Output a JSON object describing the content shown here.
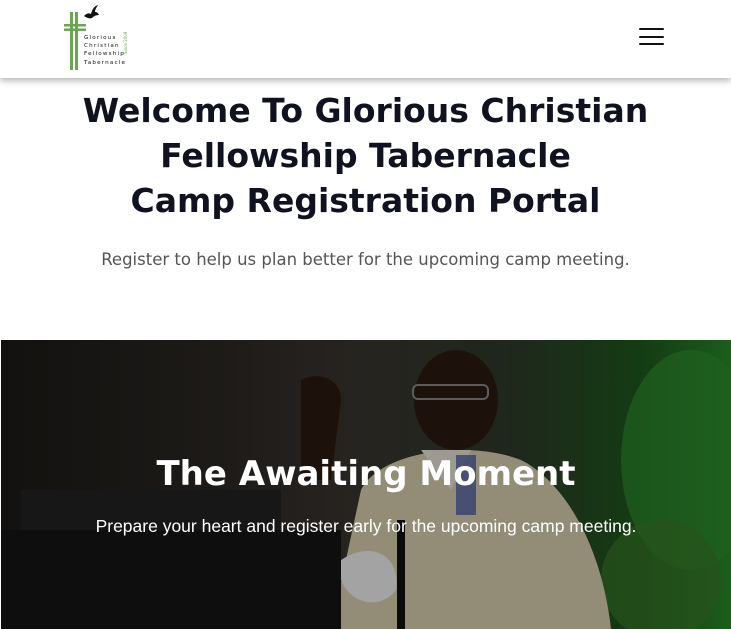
{
  "header": {
    "logo": {
      "lines": [
        "Glorious",
        "Christian",
        "Fellowship",
        "Tabernacle"
      ],
      "since": "Since 2009",
      "icons": [
        "cross-icon",
        "dove-icon"
      ],
      "colors": {
        "cross": "#6aa84f",
        "dove": "#111111"
      }
    },
    "menu_icon": "hamburger-menu-icon"
  },
  "intro": {
    "title_lines": [
      "Welcome To Glorious Christian",
      "Fellowship Tabernacle",
      "Camp Registration Portal"
    ],
    "subtitle": "Register to help us plan better for the upcoming camp meeting."
  },
  "banner": {
    "title": "The Awaiting Moment",
    "subtitle": "Prepare your heart and register early for the upcoming camp meeting."
  }
}
